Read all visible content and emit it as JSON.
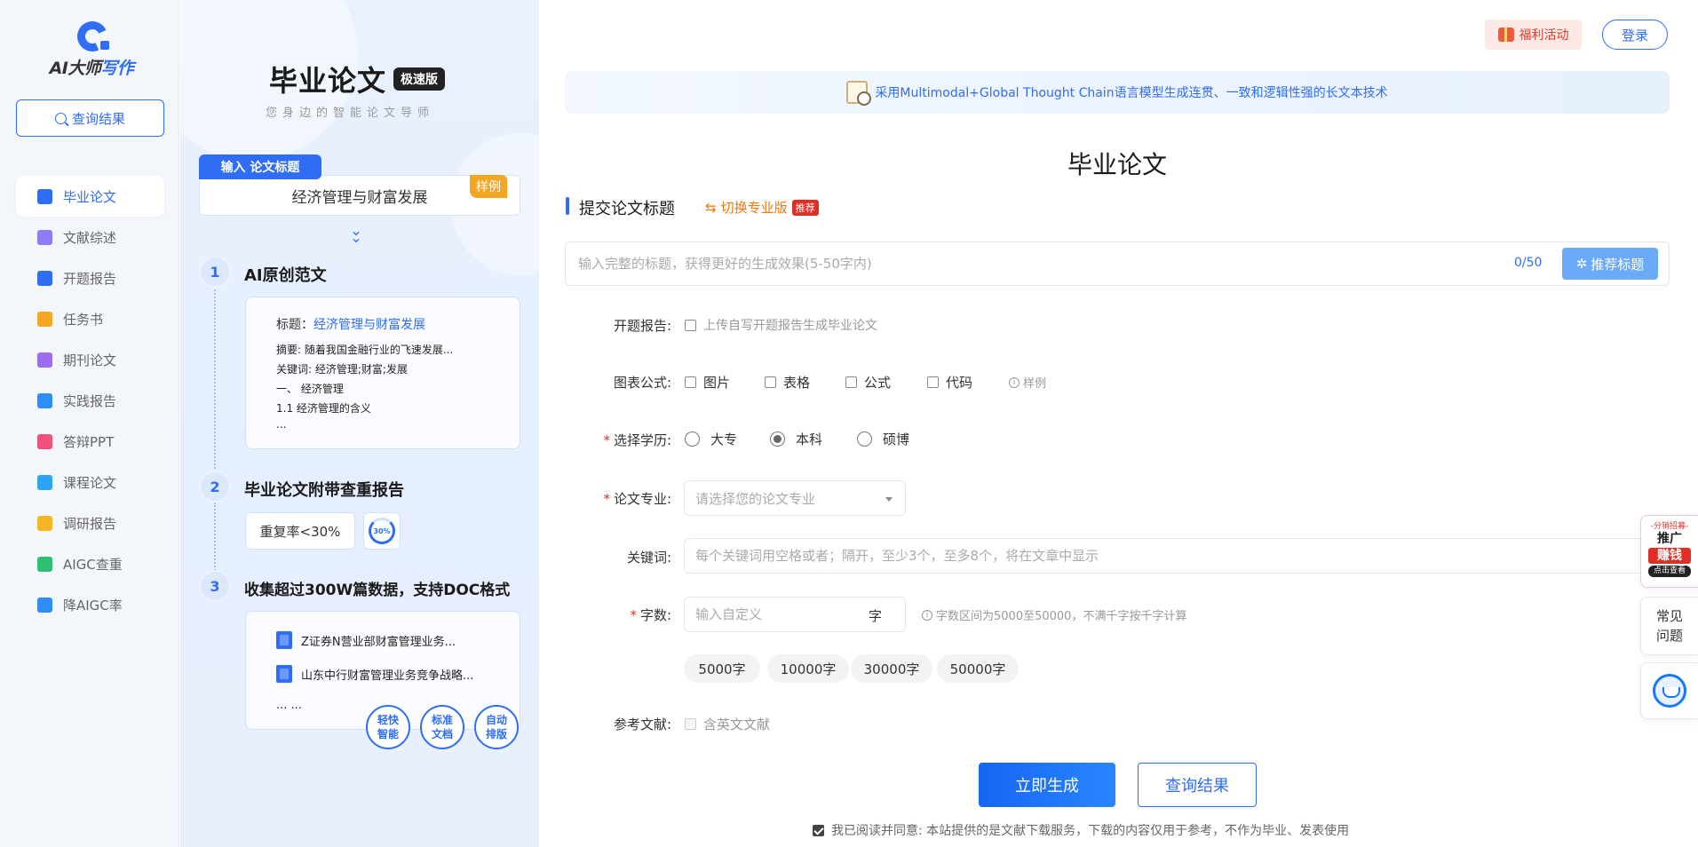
{
  "sidebar": {
    "logo_prefix": "AI大师",
    "logo_suffix": "写作",
    "query_button": "查询结果",
    "items": [
      {
        "label": "毕业论文",
        "icon": "graduation-cap-icon",
        "color": "#2f6df5",
        "active": true
      },
      {
        "label": "文献综述",
        "icon": "document-list-icon",
        "color": "#8a7ef5"
      },
      {
        "label": "开题报告",
        "icon": "report-icon",
        "color": "#2f6df5"
      },
      {
        "label": "任务书",
        "icon": "task-book-icon",
        "color": "#f5a623"
      },
      {
        "label": "期刊论文",
        "icon": "journal-icon",
        "color": "#9b6ef0"
      },
      {
        "label": "实践报告",
        "icon": "practice-report-icon",
        "color": "#2f8df5"
      },
      {
        "label": "答辩PPT",
        "icon": "ppt-icon",
        "color": "#f0507a"
      },
      {
        "label": "课程论文",
        "icon": "course-paper-icon",
        "color": "#2fa3f5"
      },
      {
        "label": "调研报告",
        "icon": "survey-icon",
        "color": "#f5b623"
      },
      {
        "label": "AIGC查重",
        "icon": "aigc-check-icon",
        "color": "#2fbf71"
      },
      {
        "label": "降AIGC率",
        "icon": "reduce-aigc-icon",
        "color": "#2f8df5"
      }
    ]
  },
  "promo": {
    "title": "毕业论文",
    "badge": "极速版",
    "subtitle": "您身边的智能论文导师",
    "input_tag": "输入 论文标题",
    "input_example": "经济管理与财富发展",
    "sample_tag": "样例",
    "steps": [
      {
        "num": "1",
        "title": "AI原创范文"
      },
      {
        "num": "2",
        "title": "毕业论文附带查重报告"
      },
      {
        "num": "3",
        "title": "收集超过300W篇数据，支持DOC格式"
      }
    ],
    "sample_card": {
      "title_label": "标题：",
      "title_value": "经济管理与财富发展",
      "abstract": "摘要: 随着我国金融行业的飞速发展...",
      "keywords": "关键词: 经济管理;财富;发展",
      "h1": "一、 经济管理",
      "h2": "1.1 经济管理的含义",
      "more": "..."
    },
    "dup_rate": "重复率<30%",
    "dup_ring": "30%",
    "docs": [
      "Z证券N营业部财富管理业务...",
      "山东中行财富管理业务竞争战略...",
      "... ..."
    ],
    "features": [
      "轻快智能",
      "标准文档",
      "自动排版"
    ]
  },
  "header": {
    "promo_button": "福利活动",
    "login_button": "登录"
  },
  "notice": "采用Multimodal+Global Thought Chain语言模型生成连贯、一致和逻辑性强的长文本技术",
  "form": {
    "page_title": "毕业论文",
    "section_title": "提交论文标题",
    "switch_label": "切换专业版",
    "switch_badge": "推荐",
    "title_placeholder": "输入完整的标题，获得更好的生成效果(5-50字内)",
    "title_value": "",
    "counter": "0/50",
    "suggest_button": "推荐标题",
    "proposal_label": "开题报告:",
    "proposal_option": "上传自写开题报告生成毕业论文",
    "chart_label": "图表公式:",
    "chart_options": [
      "图片",
      "表格",
      "公式",
      "代码"
    ],
    "chart_sample": "样例",
    "degree_label": "选择学历:",
    "degree_options": [
      "大专",
      "本科",
      "硕博"
    ],
    "degree_selected": "本科",
    "major_label": "论文专业:",
    "major_placeholder": "请选择您的论文专业",
    "keyword_label": "关键词:",
    "keyword_placeholder": "每个关键词用空格或者；隔开，至少3个，至多8个，将在文章中显示",
    "wordcount_label": "字数:",
    "wordcount_placeholder": "输入自定义",
    "wordcount_unit": "字",
    "wordcount_hint": "字数区间为5000至50000，不满千字按千字计算",
    "wordcount_presets": [
      "5000字",
      "10000字",
      "30000字",
      "50000字"
    ],
    "reference_label": "参考文献:",
    "reference_option": "含英文文献",
    "generate_button": "立即生成",
    "result_button": "查询结果",
    "agreement": "我已阅读并同意: 本站提供的是文献下载服务，下载的内容仅用于参考，不作为毕业、发表使用"
  },
  "float": {
    "promo_a": "-分销招募-",
    "promo_b": "推广",
    "promo_c": "赚钱",
    "promo_d": "点击查看",
    "faq": "常见问题"
  },
  "colors": {
    "accent": "#2f6df5",
    "warning": "#f0770b",
    "danger": "#e02e24"
  }
}
